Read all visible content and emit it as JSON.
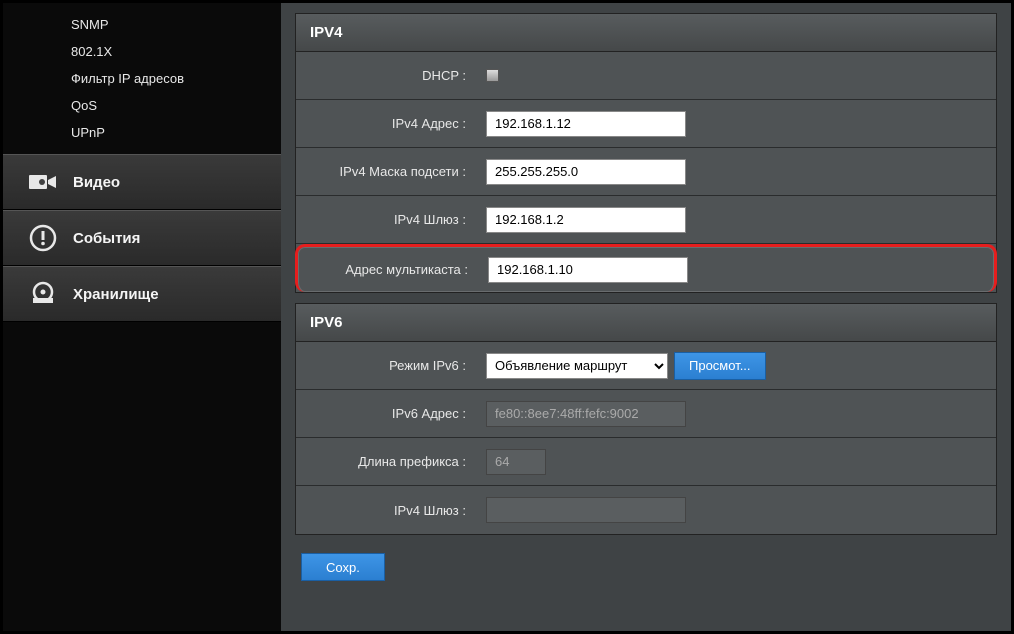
{
  "sidebar": {
    "sub_items": [
      "SNMP",
      "802.1X",
      "Фильтр IP адресов",
      "QoS",
      "UPnP"
    ],
    "main_items": [
      {
        "label": "Видео"
      },
      {
        "label": "События"
      },
      {
        "label": "Хранилище"
      }
    ]
  },
  "ipv4": {
    "title": "IPV4",
    "dhcp_label": "DHCP :",
    "addr_label": "IPv4 Адрес :",
    "addr_value": "192.168.1.12",
    "mask_label": "IPv4 Маска подсети :",
    "mask_value": "255.255.255.0",
    "gw_label": "IPv4 Шлюз :",
    "gw_value": "192.168.1.2",
    "mc_label": "Адрес мультикаста :",
    "mc_value": "192.168.1.10"
  },
  "ipv6": {
    "title": "IPV6",
    "mode_label": "Режим IPv6 :",
    "mode_value": "Объявление маршрут",
    "view_btn": "Просмот...",
    "addr_label": "IPv6 Адрес :",
    "addr_value": "fe80::8ee7:48ff:fefc:9002",
    "prefix_label": "Длина префикса :",
    "prefix_value": "64",
    "gw_label": "IPv4 Шлюз :",
    "gw_value": ""
  },
  "save_btn": "Сохр."
}
